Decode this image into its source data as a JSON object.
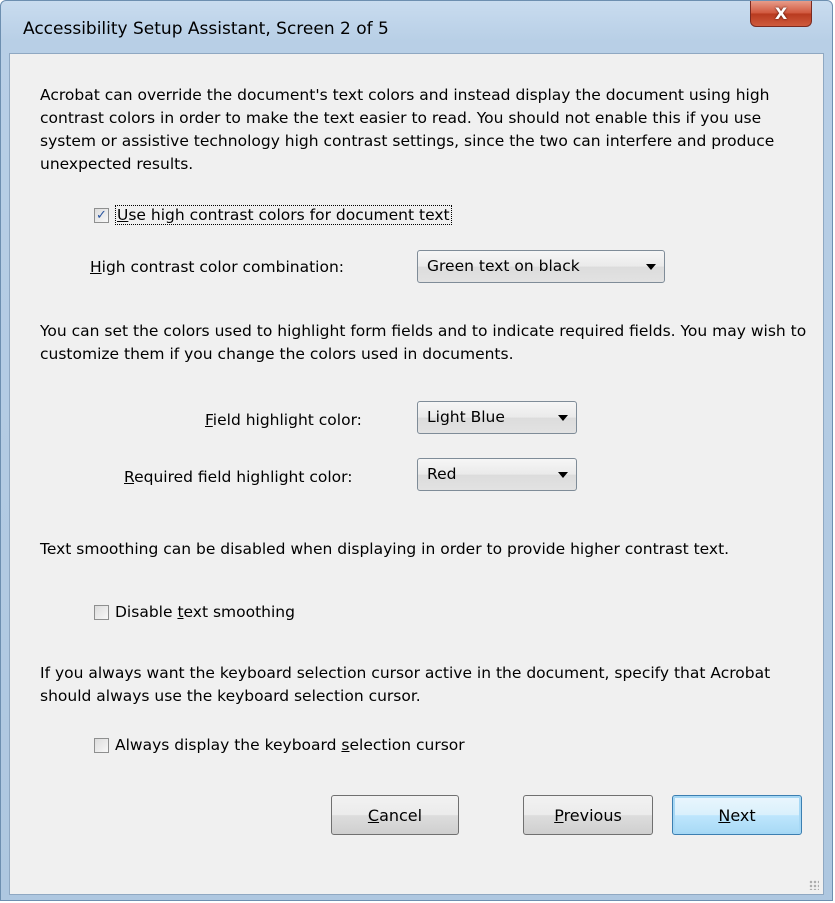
{
  "window": {
    "title": "Accessibility Setup Assistant, Screen 2 of 5",
    "close_label": "X"
  },
  "intro_text": "Acrobat can override the document's text colors and instead display the document using high contrast colors in order to make the text easier to read. You should not enable this if you use system or assistive technology high contrast settings, since the two can interfere and produce unexpected results.",
  "high_contrast_checkbox": {
    "mnemonic": "U",
    "label_rest": "se high contrast colors for document text",
    "checked": true
  },
  "high_contrast_combo": {
    "label_mnemonic": "H",
    "label_rest": "igh contrast color combination:",
    "value": "Green text on black"
  },
  "form_fields_text": "You can set the colors used to highlight form fields and to indicate required fields. You may wish to customize them if you change the colors used in documents.",
  "field_highlight": {
    "label_mnemonic": "F",
    "label_rest": "ield highlight color:",
    "value": "Light Blue"
  },
  "required_highlight": {
    "label_mnemonic": "R",
    "label_rest": "equired field highlight color:",
    "value": "Red"
  },
  "smoothing_text": "Text smoothing can be disabled when displaying in order to provide higher contrast text.",
  "smoothing_checkbox": {
    "label_before": "Disable ",
    "mnemonic": "t",
    "label_after": "ext smoothing",
    "checked": false
  },
  "cursor_text": "If you always want the keyboard selection cursor active in the document, specify that Acrobat should always use the keyboard selection cursor.",
  "cursor_checkbox": {
    "label_before": "Always display the keyboard ",
    "mnemonic": "s",
    "label_after": "election cursor",
    "checked": false
  },
  "buttons": {
    "cancel_mnemonic": "C",
    "cancel_rest": "ancel",
    "previous_mnemonic": "P",
    "previous_rest": "revious",
    "next_mnemonic": "N",
    "next_rest": "ext"
  },
  "check_glyph": "✓"
}
